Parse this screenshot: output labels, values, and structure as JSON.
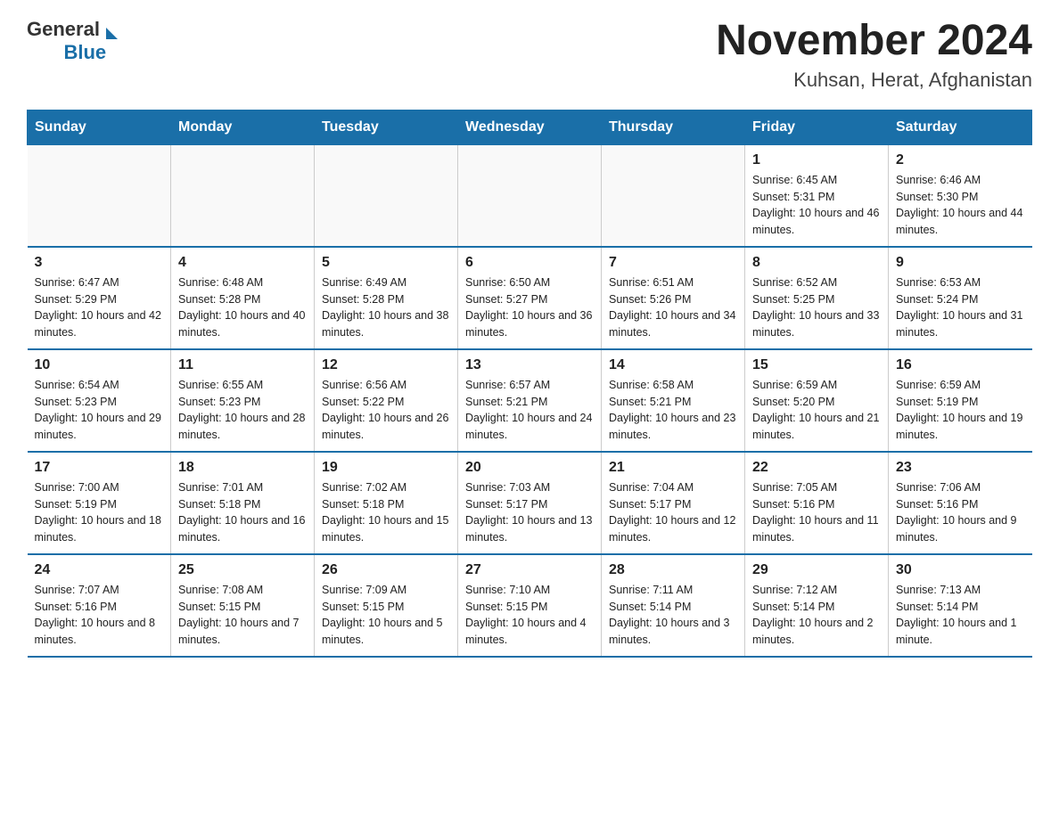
{
  "logo": {
    "general": "General",
    "blue": "Blue"
  },
  "title": "November 2024",
  "subtitle": "Kuhsan, Herat, Afghanistan",
  "days_of_week": [
    "Sunday",
    "Monday",
    "Tuesday",
    "Wednesday",
    "Thursday",
    "Friday",
    "Saturday"
  ],
  "weeks": [
    [
      {
        "day": "",
        "info": ""
      },
      {
        "day": "",
        "info": ""
      },
      {
        "day": "",
        "info": ""
      },
      {
        "day": "",
        "info": ""
      },
      {
        "day": "",
        "info": ""
      },
      {
        "day": "1",
        "info": "Sunrise: 6:45 AM\nSunset: 5:31 PM\nDaylight: 10 hours and 46 minutes."
      },
      {
        "day": "2",
        "info": "Sunrise: 6:46 AM\nSunset: 5:30 PM\nDaylight: 10 hours and 44 minutes."
      }
    ],
    [
      {
        "day": "3",
        "info": "Sunrise: 6:47 AM\nSunset: 5:29 PM\nDaylight: 10 hours and 42 minutes."
      },
      {
        "day": "4",
        "info": "Sunrise: 6:48 AM\nSunset: 5:28 PM\nDaylight: 10 hours and 40 minutes."
      },
      {
        "day": "5",
        "info": "Sunrise: 6:49 AM\nSunset: 5:28 PM\nDaylight: 10 hours and 38 minutes."
      },
      {
        "day": "6",
        "info": "Sunrise: 6:50 AM\nSunset: 5:27 PM\nDaylight: 10 hours and 36 minutes."
      },
      {
        "day": "7",
        "info": "Sunrise: 6:51 AM\nSunset: 5:26 PM\nDaylight: 10 hours and 34 minutes."
      },
      {
        "day": "8",
        "info": "Sunrise: 6:52 AM\nSunset: 5:25 PM\nDaylight: 10 hours and 33 minutes."
      },
      {
        "day": "9",
        "info": "Sunrise: 6:53 AM\nSunset: 5:24 PM\nDaylight: 10 hours and 31 minutes."
      }
    ],
    [
      {
        "day": "10",
        "info": "Sunrise: 6:54 AM\nSunset: 5:23 PM\nDaylight: 10 hours and 29 minutes."
      },
      {
        "day": "11",
        "info": "Sunrise: 6:55 AM\nSunset: 5:23 PM\nDaylight: 10 hours and 28 minutes."
      },
      {
        "day": "12",
        "info": "Sunrise: 6:56 AM\nSunset: 5:22 PM\nDaylight: 10 hours and 26 minutes."
      },
      {
        "day": "13",
        "info": "Sunrise: 6:57 AM\nSunset: 5:21 PM\nDaylight: 10 hours and 24 minutes."
      },
      {
        "day": "14",
        "info": "Sunrise: 6:58 AM\nSunset: 5:21 PM\nDaylight: 10 hours and 23 minutes."
      },
      {
        "day": "15",
        "info": "Sunrise: 6:59 AM\nSunset: 5:20 PM\nDaylight: 10 hours and 21 minutes."
      },
      {
        "day": "16",
        "info": "Sunrise: 6:59 AM\nSunset: 5:19 PM\nDaylight: 10 hours and 19 minutes."
      }
    ],
    [
      {
        "day": "17",
        "info": "Sunrise: 7:00 AM\nSunset: 5:19 PM\nDaylight: 10 hours and 18 minutes."
      },
      {
        "day": "18",
        "info": "Sunrise: 7:01 AM\nSunset: 5:18 PM\nDaylight: 10 hours and 16 minutes."
      },
      {
        "day": "19",
        "info": "Sunrise: 7:02 AM\nSunset: 5:18 PM\nDaylight: 10 hours and 15 minutes."
      },
      {
        "day": "20",
        "info": "Sunrise: 7:03 AM\nSunset: 5:17 PM\nDaylight: 10 hours and 13 minutes."
      },
      {
        "day": "21",
        "info": "Sunrise: 7:04 AM\nSunset: 5:17 PM\nDaylight: 10 hours and 12 minutes."
      },
      {
        "day": "22",
        "info": "Sunrise: 7:05 AM\nSunset: 5:16 PM\nDaylight: 10 hours and 11 minutes."
      },
      {
        "day": "23",
        "info": "Sunrise: 7:06 AM\nSunset: 5:16 PM\nDaylight: 10 hours and 9 minutes."
      }
    ],
    [
      {
        "day": "24",
        "info": "Sunrise: 7:07 AM\nSunset: 5:16 PM\nDaylight: 10 hours and 8 minutes."
      },
      {
        "day": "25",
        "info": "Sunrise: 7:08 AM\nSunset: 5:15 PM\nDaylight: 10 hours and 7 minutes."
      },
      {
        "day": "26",
        "info": "Sunrise: 7:09 AM\nSunset: 5:15 PM\nDaylight: 10 hours and 5 minutes."
      },
      {
        "day": "27",
        "info": "Sunrise: 7:10 AM\nSunset: 5:15 PM\nDaylight: 10 hours and 4 minutes."
      },
      {
        "day": "28",
        "info": "Sunrise: 7:11 AM\nSunset: 5:14 PM\nDaylight: 10 hours and 3 minutes."
      },
      {
        "day": "29",
        "info": "Sunrise: 7:12 AM\nSunset: 5:14 PM\nDaylight: 10 hours and 2 minutes."
      },
      {
        "day": "30",
        "info": "Sunrise: 7:13 AM\nSunset: 5:14 PM\nDaylight: 10 hours and 1 minute."
      }
    ]
  ]
}
